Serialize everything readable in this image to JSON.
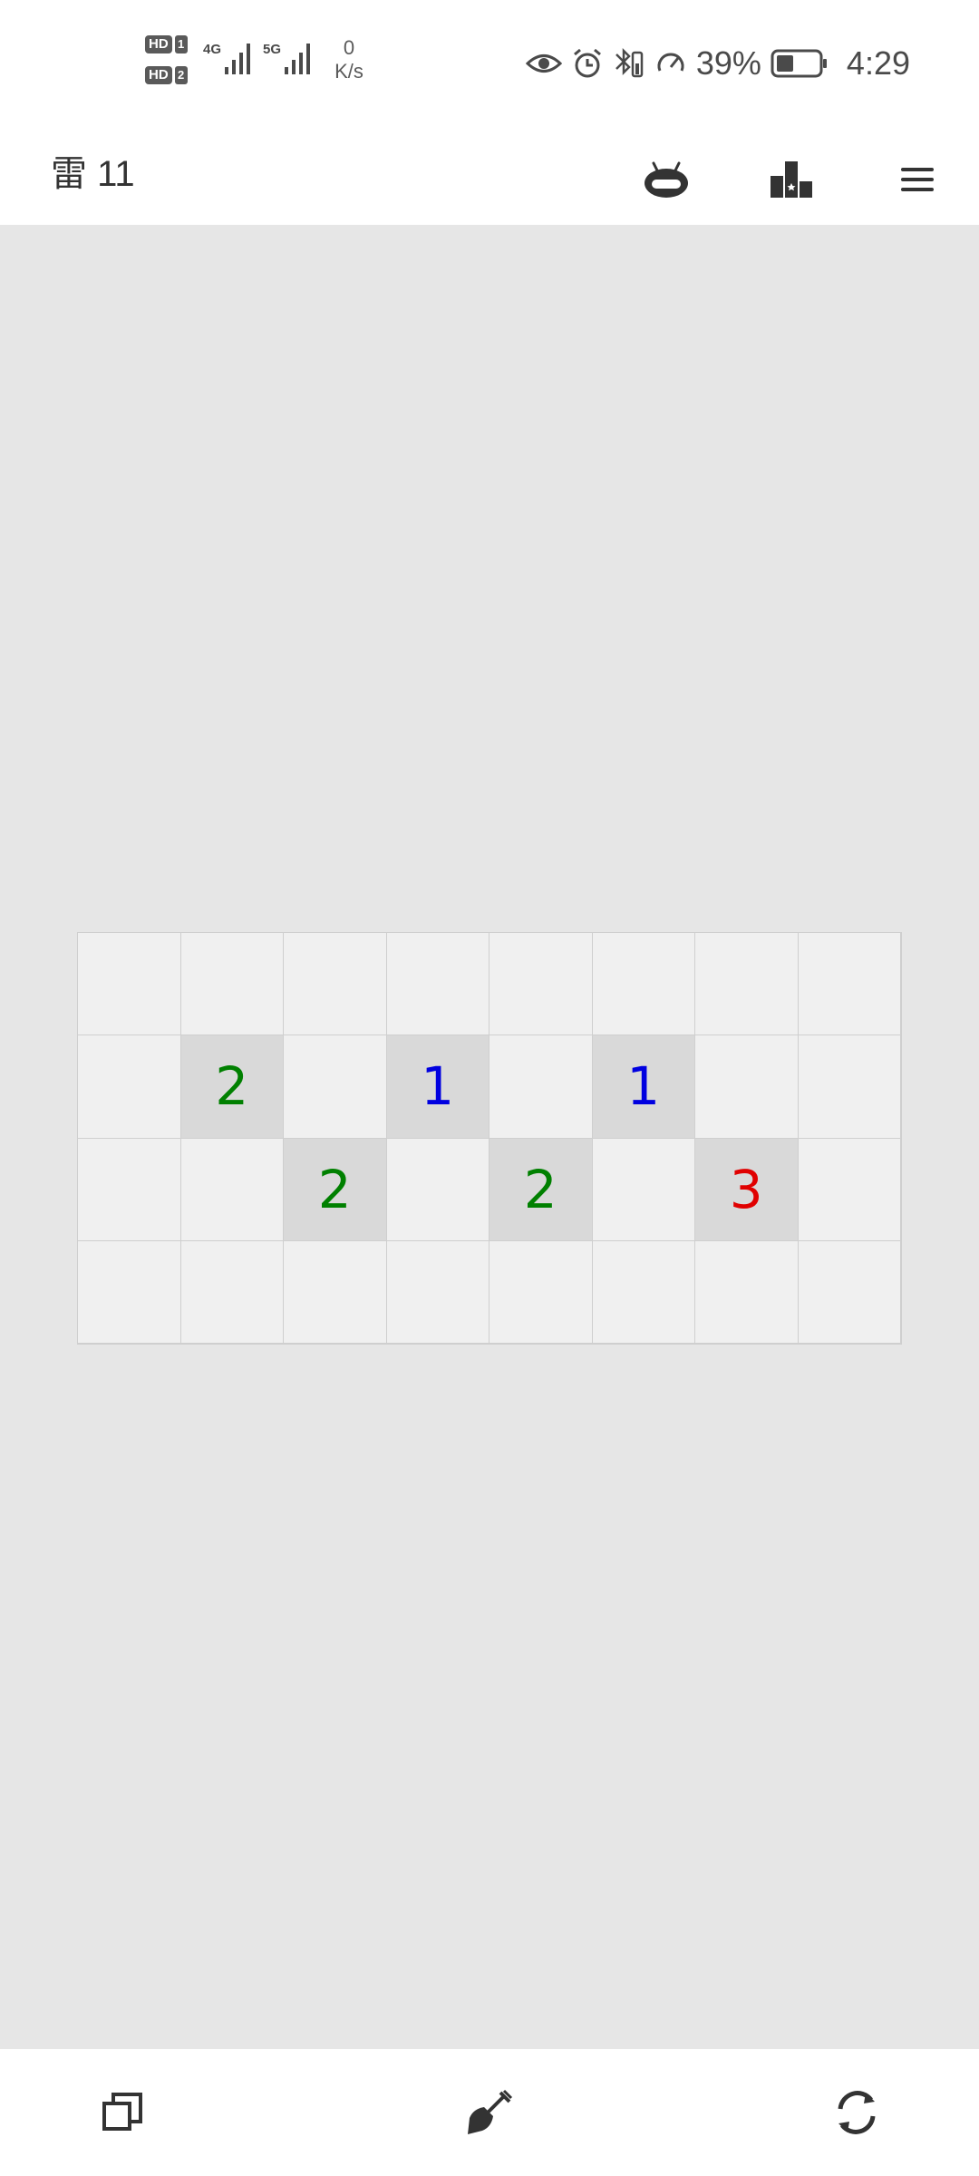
{
  "status_bar": {
    "sim1_label": "HD",
    "sim1_number": "1",
    "sim2_label": "HD",
    "sim2_number": "2",
    "network1": "4G",
    "network2": "5G",
    "speed_value": "0",
    "speed_unit": "K/s",
    "battery_percent": "39%",
    "time": "4:29",
    "icons": [
      "eye-icon",
      "alarm-icon",
      "bluetooth-icon",
      "speedometer-icon",
      "battery-icon"
    ]
  },
  "toolbar": {
    "mine_counter": "雷 11",
    "icons": [
      "robot-icon",
      "leaderboard-icon",
      "menu-icon"
    ]
  },
  "board": {
    "rows": 4,
    "cols": 8,
    "cells": [
      [
        {
          "state": "hidden",
          "value": ""
        },
        {
          "state": "hidden",
          "value": ""
        },
        {
          "state": "hidden",
          "value": ""
        },
        {
          "state": "hidden",
          "value": ""
        },
        {
          "state": "hidden",
          "value": ""
        },
        {
          "state": "hidden",
          "value": ""
        },
        {
          "state": "hidden",
          "value": ""
        },
        {
          "state": "hidden",
          "value": ""
        }
      ],
      [
        {
          "state": "hidden",
          "value": ""
        },
        {
          "state": "revealed",
          "value": "2"
        },
        {
          "state": "hidden",
          "value": ""
        },
        {
          "state": "revealed",
          "value": "1"
        },
        {
          "state": "hidden",
          "value": ""
        },
        {
          "state": "revealed",
          "value": "1"
        },
        {
          "state": "hidden",
          "value": ""
        },
        {
          "state": "hidden",
          "value": ""
        }
      ],
      [
        {
          "state": "hidden",
          "value": ""
        },
        {
          "state": "hidden",
          "value": ""
        },
        {
          "state": "revealed",
          "value": "2"
        },
        {
          "state": "hidden",
          "value": ""
        },
        {
          "state": "revealed",
          "value": "2"
        },
        {
          "state": "hidden",
          "value": ""
        },
        {
          "state": "revealed",
          "value": "3"
        },
        {
          "state": "hidden",
          "value": ""
        }
      ],
      [
        {
          "state": "hidden",
          "value": ""
        },
        {
          "state": "hidden",
          "value": ""
        },
        {
          "state": "hidden",
          "value": ""
        },
        {
          "state": "hidden",
          "value": ""
        },
        {
          "state": "hidden",
          "value": ""
        },
        {
          "state": "hidden",
          "value": ""
        },
        {
          "state": "hidden",
          "value": ""
        },
        {
          "state": "hidden",
          "value": ""
        }
      ]
    ]
  },
  "number_colors": {
    "1": "#0000e0",
    "2": "#008000",
    "3": "#e00000"
  },
  "bottom_bar": {
    "icons": [
      "copy-icon",
      "shovel-icon",
      "restart-icon"
    ]
  }
}
